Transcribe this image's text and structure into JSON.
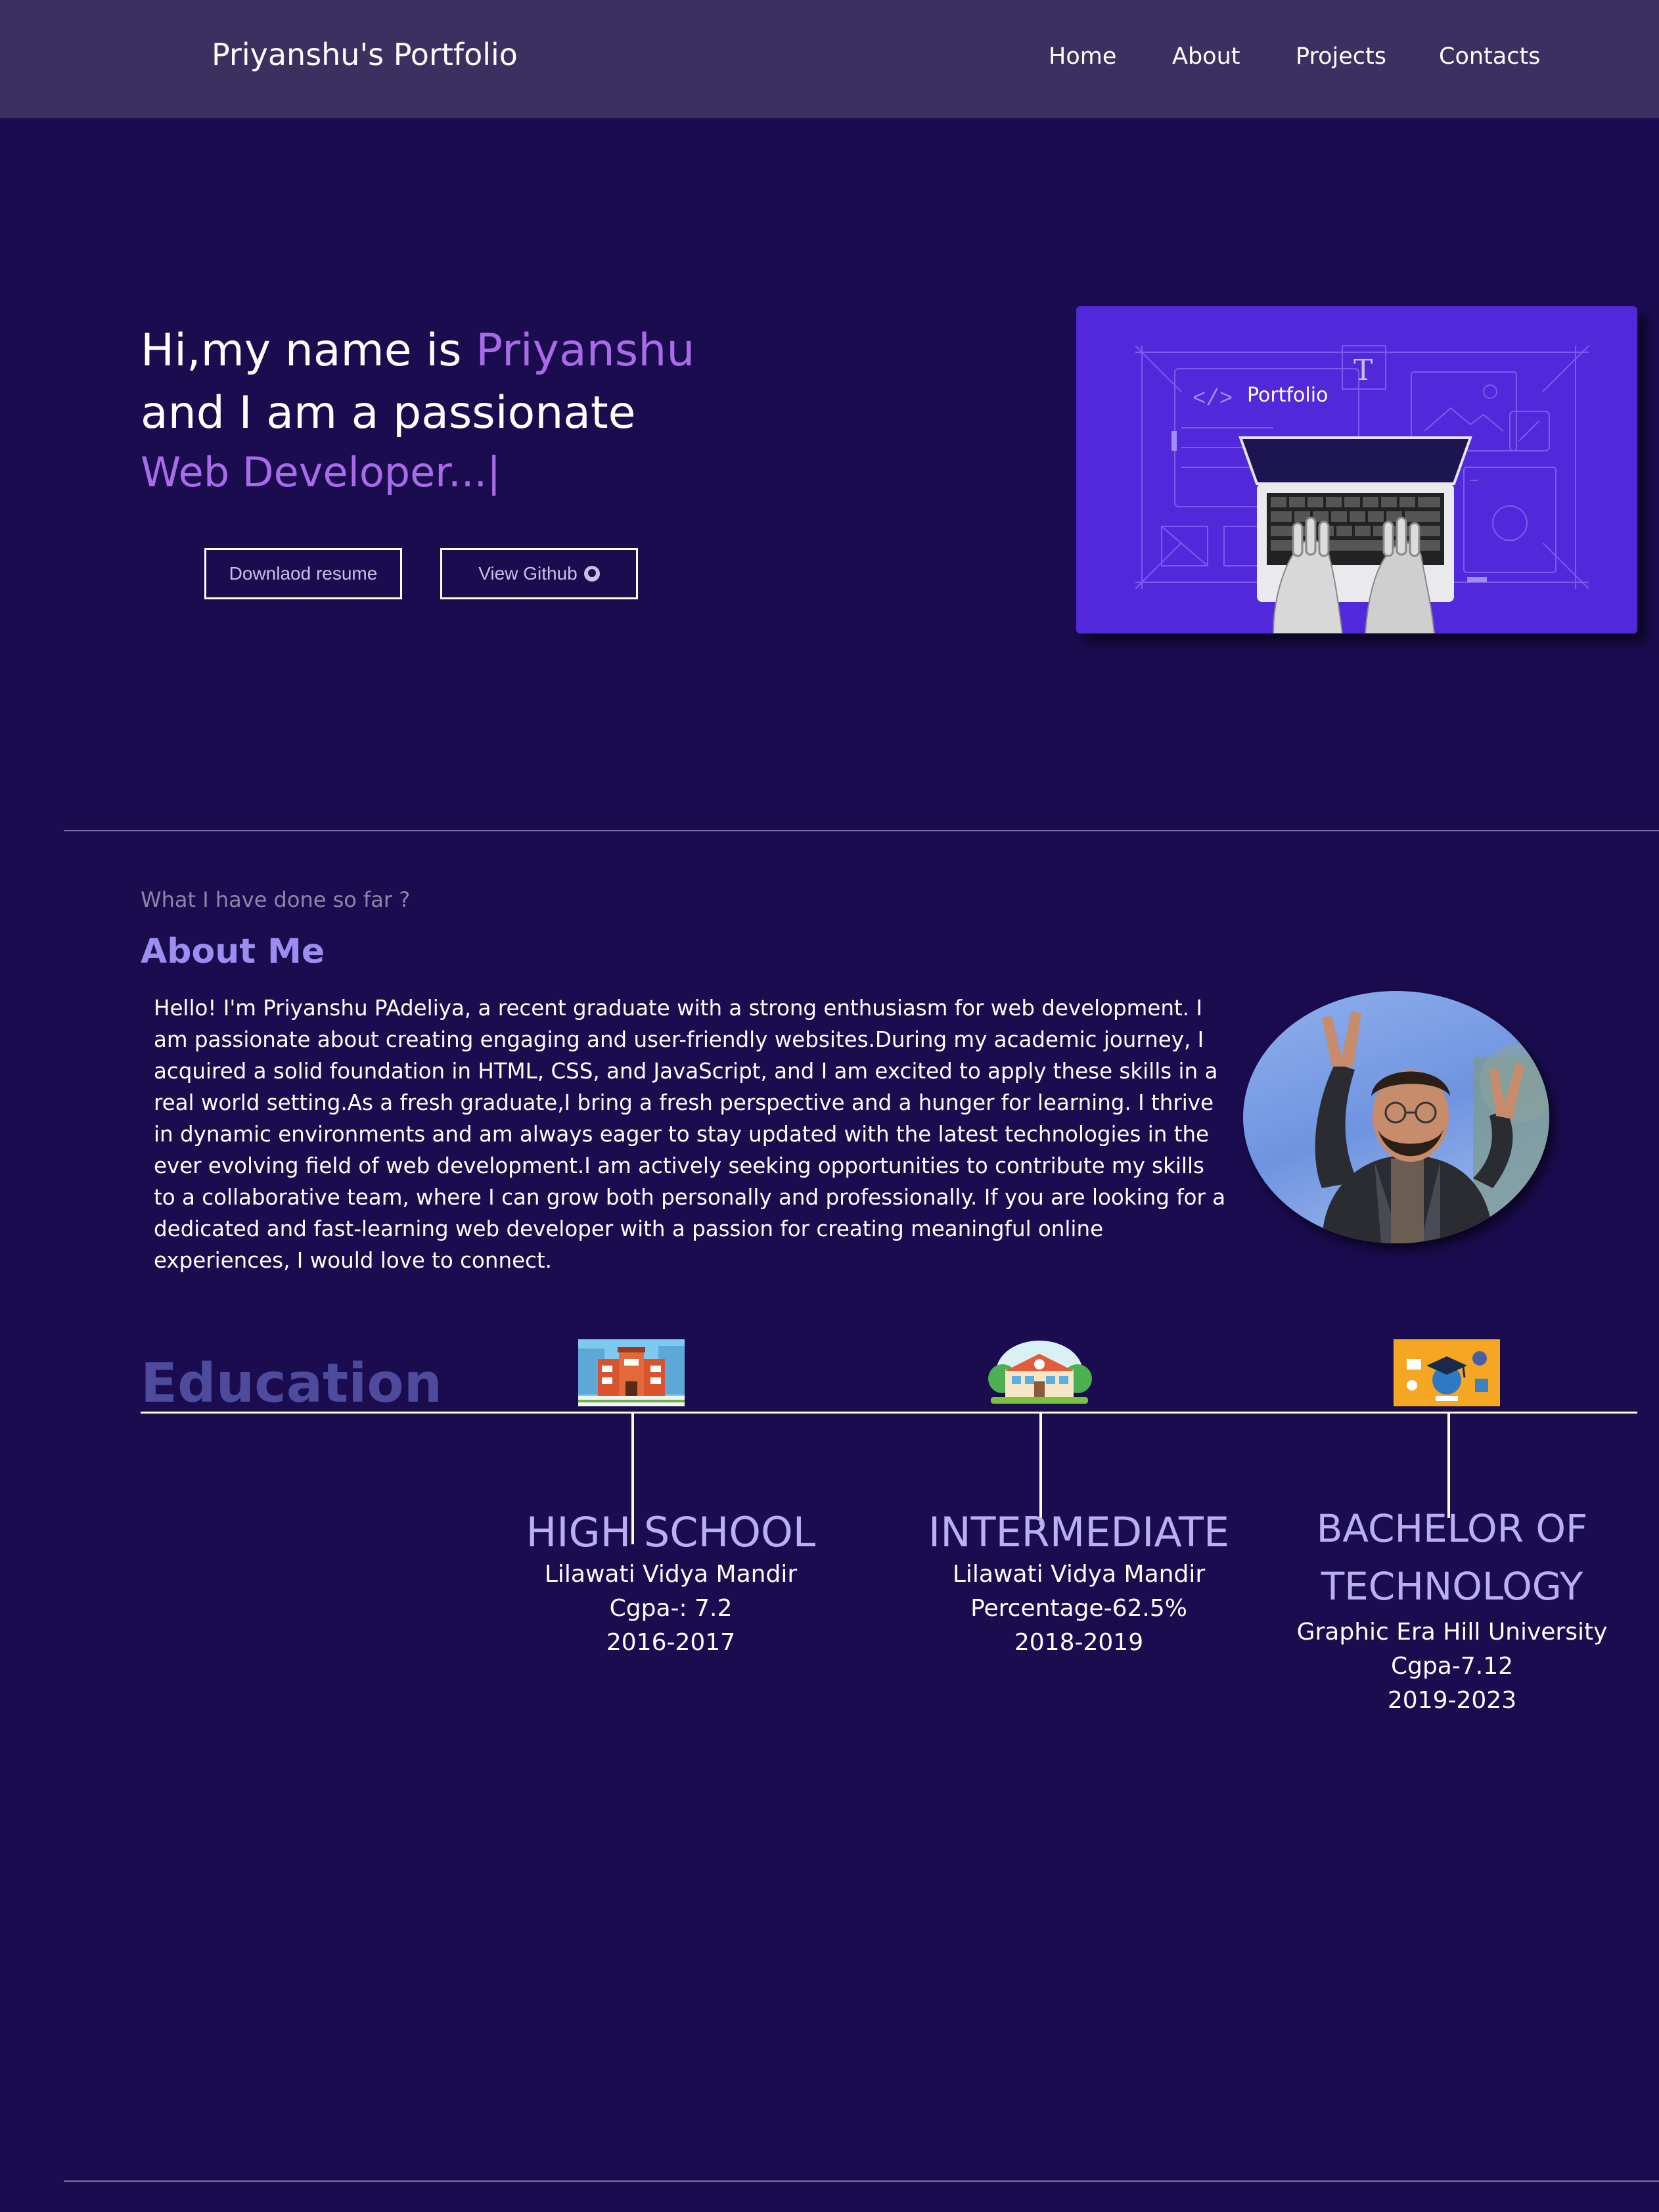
{
  "navbar": {
    "brand": "Priyanshu's Portfolio",
    "links": [
      "Home",
      "About",
      "Projects",
      "Contacts"
    ]
  },
  "hero": {
    "line1_prefix": "Hi,my name is ",
    "line1_name": "Priyanshu",
    "line2": "and I am a passionate",
    "line3": "Web Developer...",
    "cursor": "|",
    "buttons": {
      "resume": "Downlaod resume",
      "github": "View Github"
    },
    "illustration_label": "Portfolio"
  },
  "about": {
    "kicker": "What I have done so far ?",
    "title": "About Me",
    "text": "Hello! I'm Priyanshu PAdeliya, a recent graduate with a strong enthusiasm for web development. I am passionate about creating engaging and user-friendly websites.During my academic journey, I acquired a solid foundation in HTML, CSS, and JavaScript, and I am excited to apply these skills in a real world setting.As a fresh graduate,I bring a fresh perspective and a hunger for learning. I thrive in dynamic environments and am always eager to stay updated with the latest technologies in the ever evolving field of web development.I am actively seeking opportunities to contribute my skills to a collaborative team, where I can grow both personally and professionally. If you are looking for a dedicated and fast-learning web developer with a passion for creating meaningful online experiences, I would love to connect."
  },
  "education": {
    "title": "Education",
    "items": [
      {
        "degree": "HIGH SCHOOL",
        "school": "Lilawati Vidya Mandir",
        "score": "Cgpa-: 7.2",
        "years": "2016-2017",
        "icon": "school-building-icon"
      },
      {
        "degree": "INTERMEDIATE",
        "school": "Lilawati Vidya Mandir",
        "score": "Percentage-62.5%",
        "years": "2018-2019",
        "icon": "college-building-icon"
      },
      {
        "degree_line1": "BACHELOR OF",
        "degree_line2": "TECHNOLOGY",
        "school": "Graphic Era Hill University",
        "score": "Cgpa-7.12",
        "years": "2019-2023",
        "icon": "graduation-icon"
      }
    ]
  },
  "colors": {
    "background": "#1a0c4f",
    "navbar": "#3b305f",
    "accent": "#a96ce8",
    "heading": "#9a8ef0",
    "education_title": "#4e4a9c"
  }
}
